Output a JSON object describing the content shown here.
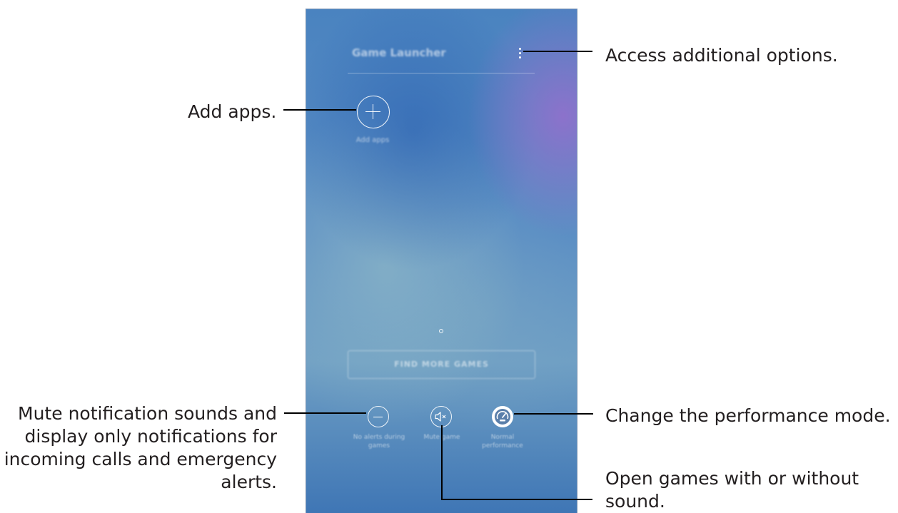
{
  "phone": {
    "title": "Game Launcher",
    "add_apps_label": "Add apps",
    "find_more_games_label": "FIND MORE GAMES",
    "quick_settings": [
      {
        "label": "No alerts during games"
      },
      {
        "label": "Mute game"
      },
      {
        "label": "Normal performance"
      }
    ]
  },
  "callouts": {
    "access_options": "Access additional options.",
    "add_apps": "Add apps.",
    "mute_notifications": [
      "Mute notification sounds and",
      "display only notifications for",
      "incoming calls and emergency",
      "alerts."
    ],
    "performance_mode": "Change the performance mode.",
    "open_games_sound": [
      "Open games with or without",
      "sound."
    ]
  },
  "colors": {
    "callout_text": "#231f20",
    "leader_line": "#000000",
    "phone_background": "#4a83c0",
    "phone_border": "#7d95b3"
  },
  "icons": [
    "more-options-icon",
    "plus-icon",
    "minus-icon",
    "mute-speaker-icon",
    "speedometer-icon"
  ]
}
